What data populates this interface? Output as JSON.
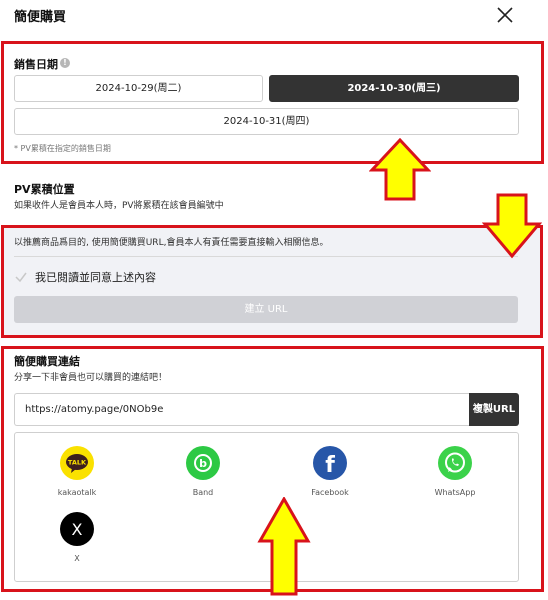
{
  "header": {
    "title": "簡便購買"
  },
  "sales_date": {
    "label": "銷售日期",
    "info_glyph": "!",
    "dates": [
      "2024-10-29(周二)",
      "2024-10-30(周三)",
      "2024-10-31(周四)"
    ],
    "selected": "2024-10-30(周三)",
    "note": "* PV累積在指定的銷售日期"
  },
  "pv_location": {
    "title": "PV累積位置",
    "description": "如果收件人是會員本人時，PV將累積在該會員編號中"
  },
  "consent": {
    "notice": "以推薦商品爲目的, 使用簡便購買URL,會員本人有責任需要直接輸入相關信息。",
    "checkbox_label": "我已閱讀並同意上述內容",
    "checked": false,
    "create_button": "建立 URL"
  },
  "quick_link": {
    "title": "簡便購買連結",
    "description": "分享一下非會員也可以購買的連結吧！",
    "url": "https://atomy.page/0NOb9e",
    "copy_button": "複製URL",
    "share": [
      {
        "name": "kakaotalk",
        "icon": "kakaotalk-icon",
        "color": "#fae100",
        "glyph": "TALK"
      },
      {
        "name": "Band",
        "icon": "band-icon",
        "color": "#2dc944",
        "glyph": "b"
      },
      {
        "name": "Facebook",
        "icon": "facebook-icon",
        "color": "#2756a8",
        "glyph": "f"
      },
      {
        "name": "WhatsApp",
        "icon": "whatsapp-icon",
        "color": "#3bd24a",
        "glyph": ""
      },
      {
        "name": "X",
        "icon": "x-icon",
        "color": "#000000",
        "glyph": "X"
      }
    ]
  },
  "annotations": {
    "box_color": "#d8131b",
    "arrow_color": "#ffff00"
  }
}
